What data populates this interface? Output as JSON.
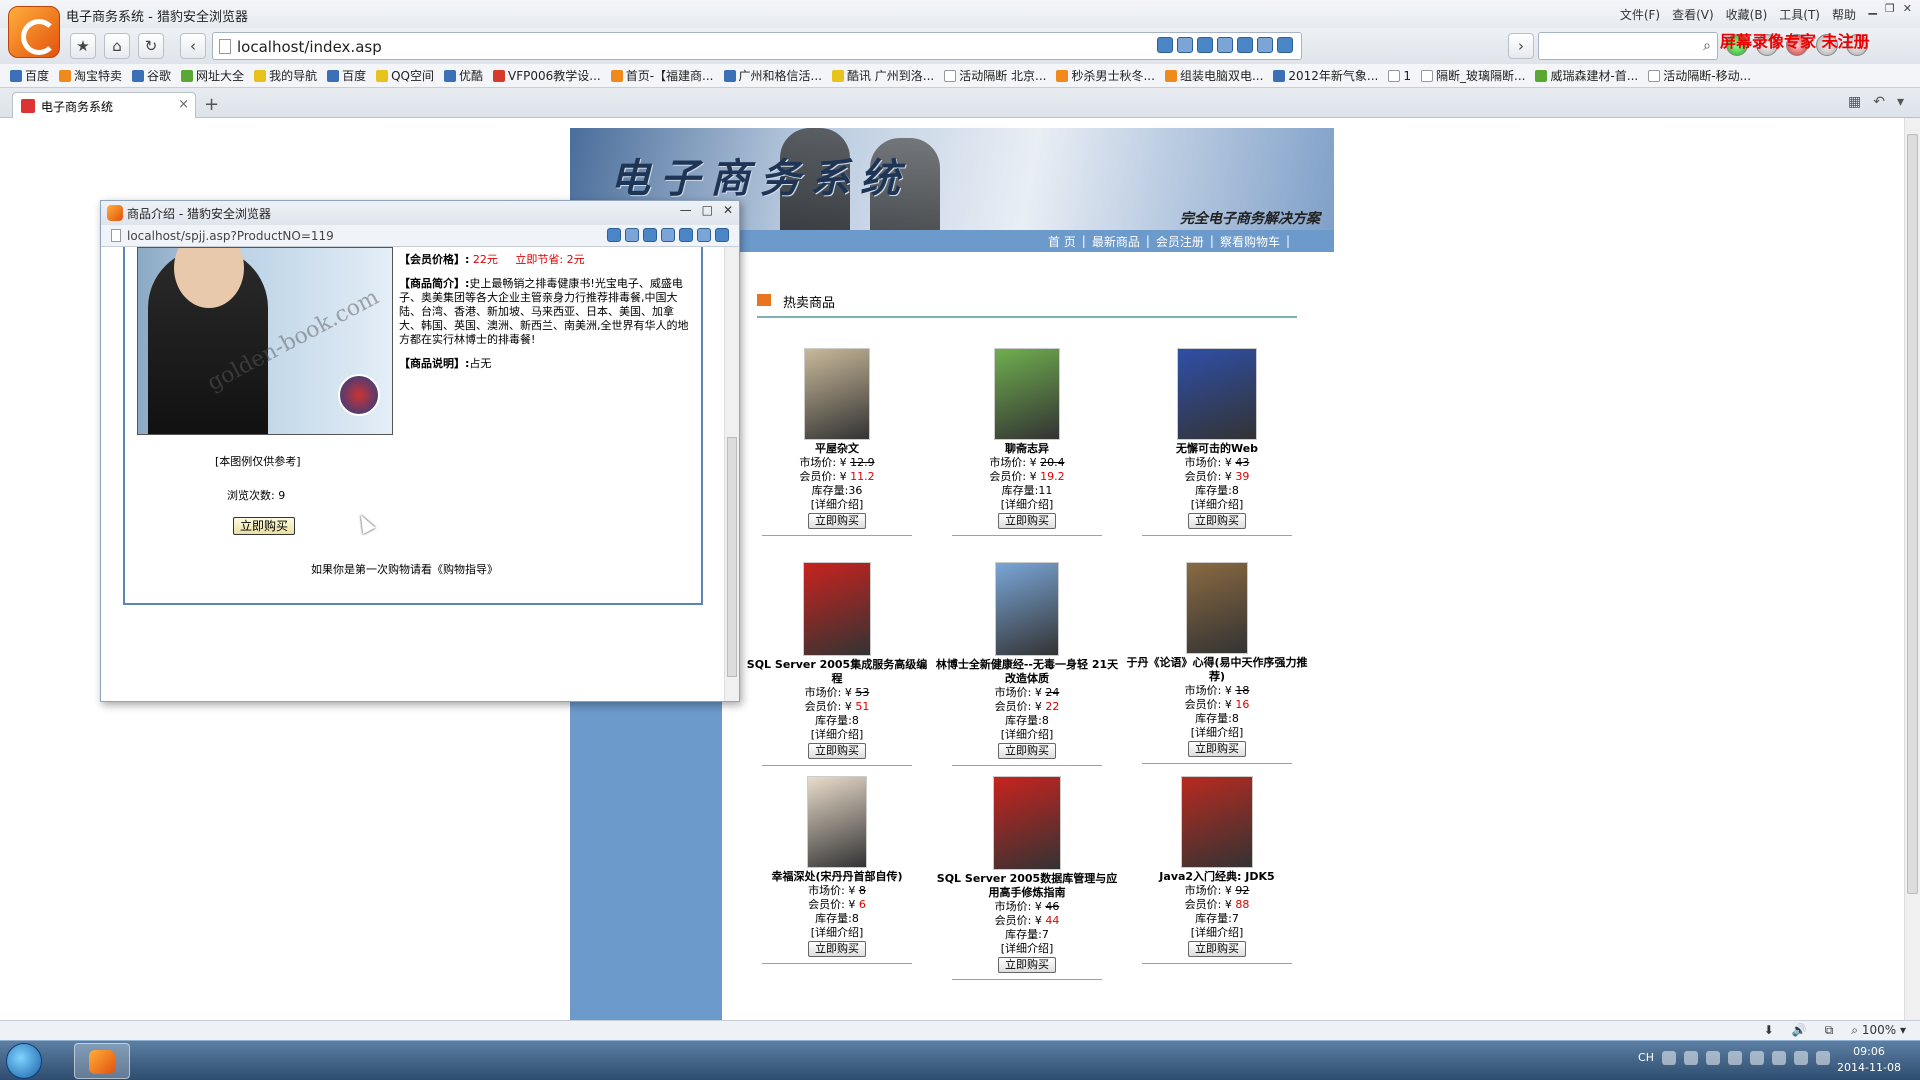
{
  "browser": {
    "window_title": "电子商务系统 - 猎豹安全浏览器",
    "menu": [
      "文件(F)",
      "查看(V)",
      "收藏(B)",
      "工具(T)",
      "帮助"
    ],
    "watermark": "屏幕录像专家 未注册",
    "url": "localhost/index.asp",
    "bookmarks": [
      "百度",
      "淘宝特卖",
      "谷歌",
      "网址大全",
      "我的导航",
      "百度",
      "QQ空间",
      "优酷",
      "VFP006教学设...",
      "首页-【福建商...",
      "广州和格信活...",
      "酷讯 广州到洛...",
      "活动隔断 北京...",
      "秒杀男士秋冬...",
      "组装电脑双电...",
      "2012年新气象...",
      "1",
      "隔断_玻璃隔断...",
      "威瑞森建材-首...",
      "活动隔断-移动..."
    ],
    "tab_label": "电子商务系统",
    "status_zoom": "100%",
    "taskbar_time": "09:06",
    "taskbar_date": "2014-11-08",
    "taskbar_lang": "CH"
  },
  "site": {
    "banner_title": "电子商务系统",
    "banner_subtitle": "完全电子商务解决方案",
    "nav": [
      "首  页",
      "最新商品",
      "会员注册",
      "察看购物车"
    ],
    "hot_title": "热卖商品"
  },
  "products": [
    {
      "name": "平屋杂文",
      "market_label": "市场价: ¥",
      "market": "12.9",
      "member_label": "会员价: ¥",
      "member": "11.2",
      "stock": "库存量:36",
      "detail": "[详细介绍]",
      "buy": "立即购买",
      "cover_color": "#c9b99a"
    },
    {
      "name": "聊斋志异",
      "market_label": "市场价: ¥",
      "market": "20.4",
      "member_label": "会员价: ¥",
      "member": "19.2",
      "stock": "库存量:11",
      "detail": "[详细介绍]",
      "buy": "立即购买",
      "cover_color": "#6fae4f"
    },
    {
      "name": "无懈可击的Web",
      "market_label": "市场价: ¥",
      "market": "43",
      "member_label": "会员价: ¥",
      "member": "39",
      "stock": "库存量:8",
      "detail": "[详细介绍]",
      "buy": "立即购买",
      "cover_color": "#2f4fa8"
    },
    {
      "name": "SQL Server 2005集成服务高级编程",
      "market_label": "市场价: ¥",
      "market": "53",
      "member_label": "会员价: ¥",
      "member": "51",
      "stock": "库存量:8",
      "detail": "[详细介绍]",
      "buy": "立即购买",
      "cover_color": "#c8231f"
    },
    {
      "name": "林博士全新健康经--无毒一身轻 21天改造体质",
      "market_label": "市场价: ¥",
      "market": "24",
      "member_label": "会员价: ¥",
      "member": "22",
      "stock": "库存量:8",
      "detail": "[详细介绍]",
      "buy": "立即购买",
      "cover_color": "#7aa6d8"
    },
    {
      "name": "于丹《论语》心得(易中天作序强力推荐)",
      "market_label": "市场价: ¥",
      "market": "18",
      "member_label": "会员价: ¥",
      "member": "16",
      "stock": "库存量:8",
      "detail": "[详细介绍]",
      "buy": "立即购买",
      "cover_color": "#8a6a42"
    },
    {
      "name": "幸福深处(宋丹丹首部自传)",
      "market_label": "市场价: ¥",
      "market": "8",
      "member_label": "会员价: ¥",
      "member": "6",
      "stock": "库存量:8",
      "detail": "[详细介绍]",
      "buy": "立即购买",
      "cover_color": "#e9dccb"
    },
    {
      "name": "SQL Server 2005数据库管理与应用高手修炼指南",
      "market_label": "市场价: ¥",
      "market": "46",
      "member_label": "会员价: ¥",
      "member": "44",
      "stock": "库存量:7",
      "detail": "[详细介绍]",
      "buy": "立即购买",
      "cover_color": "#c8231f"
    },
    {
      "name": "Java2入门经典: JDK5",
      "market_label": "市场价: ¥",
      "market": "92",
      "member_label": "会员价: ¥",
      "member": "88",
      "stock": "库存量:7",
      "detail": "[详细介绍]",
      "buy": "立即购买",
      "cover_color": "#b82a20"
    }
  ],
  "popup": {
    "title": "商品介绍 - 猎豹安全浏览器",
    "url": "localhost/spjj.asp?ProductNO=119",
    "member_price_label": "【会员价格】:",
    "member_price": "22元",
    "saving": "立即节省: 2元",
    "intro_label": "【商品简介】:",
    "intro": "史上最畅销之排毒健康书!光宝电子、威盛电子、奥美集团等各大企业主管亲身力行推荐排毒餐,中国大陆、台湾、香港、新加坡、马来西亚、日本、美国、加拿大、韩国、英国、澳洲、新西兰、南美洲,全世界有华人的地方都在实行林博士的排毒餐!",
    "desc_label": "【商品说明】:",
    "desc": "占无",
    "image_note": "[本图例仅供参考]",
    "view_count": "浏览次数: 9",
    "buy": "立即购买",
    "guide": "如果你是第一次购物请看《购物指导》",
    "image_watermark": "golden-book.com"
  }
}
